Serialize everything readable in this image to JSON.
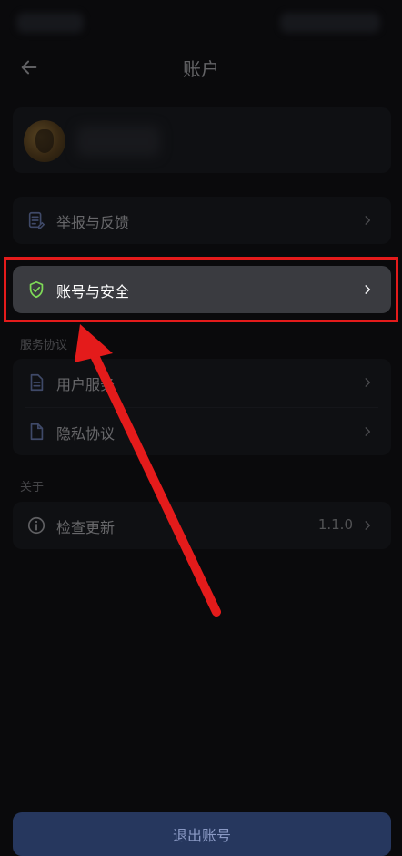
{
  "header": {
    "title": "账户",
    "back_icon": "arrow-left-icon"
  },
  "menu": {
    "report_feedback": {
      "label": "举报与反馈",
      "icon": "report-document-icon"
    },
    "account_security": {
      "label": "账号与安全",
      "icon": "shield-check-icon"
    }
  },
  "sections": {
    "service_agreement": {
      "title": "服务协议",
      "items": [
        {
          "label": "用户服务",
          "icon": "document-icon"
        },
        {
          "label": "隐私协议",
          "icon": "file-icon"
        }
      ]
    },
    "about": {
      "title": "关于",
      "check_update": {
        "label": "检查更新",
        "version": "1.1.0",
        "icon": "info-icon"
      }
    }
  },
  "logout": {
    "label": "退出账号"
  },
  "colors": {
    "highlight": "#e41b1b",
    "shield": "#7ed957",
    "accent_button": "#26375e"
  }
}
